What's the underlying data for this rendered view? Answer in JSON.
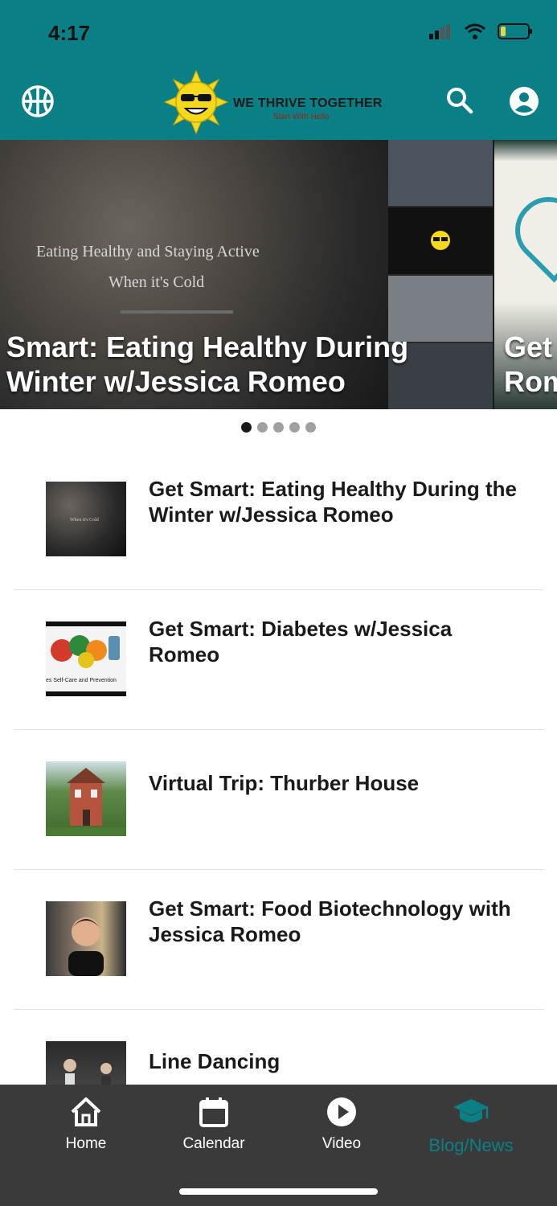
{
  "status_bar": {
    "time": "4:17"
  },
  "app_bar": {
    "brand_title": "WE THRIVE TOGETHER",
    "brand_tagline": "Start With Hello",
    "colors": {
      "accent": "#0b7f86"
    }
  },
  "carousel": {
    "slides": [
      {
        "caption": "Smart: Eating Healthy During Winter w/Jessica Romeo",
        "inner_title": "Eating Healthy and Staying Active",
        "inner_subtitle": "When it's Cold"
      },
      {
        "caption": "Get Rom"
      }
    ],
    "active_index": 0,
    "dot_count": 5
  },
  "posts": [
    {
      "title": "Get Smart: Eating Healthy During the Winter w/Jessica Romeo",
      "thumb_text": "When it's Cold"
    },
    {
      "title": "Get Smart: Diabetes w/Jessica Romeo",
      "thumb_text": "es Self-Care and Prevention"
    },
    {
      "title": "Virtual Trip: Thurber House"
    },
    {
      "title": "Get Smart: Food Biotechnology with Jessica Romeo"
    },
    {
      "title": "Line Dancing"
    }
  ],
  "tab_bar": {
    "tabs": [
      {
        "label": "Home",
        "icon": "home-icon"
      },
      {
        "label": "Calendar",
        "icon": "calendar-icon"
      },
      {
        "label": "Video",
        "icon": "play-circle-icon"
      },
      {
        "label": "Blog/News",
        "icon": "graduation-cap-icon",
        "active": true
      }
    ]
  }
}
